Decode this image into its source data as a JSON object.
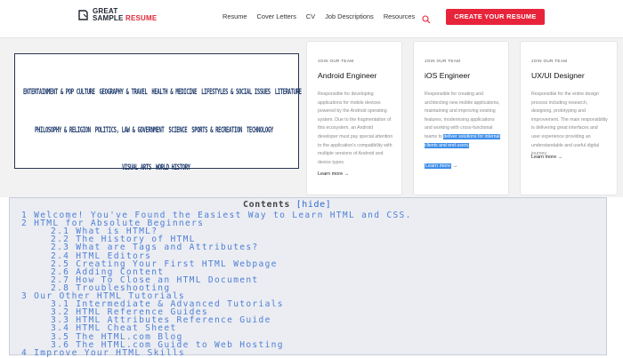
{
  "header": {
    "logo_line1": "GREAT",
    "logo_line2a": "SAMPLE ",
    "logo_line2b": "RESUME",
    "nav": [
      "Resume",
      "Cover Letters",
      "CV",
      "Job Descriptions",
      "Resources"
    ],
    "cta_label": "CREATE YOUR RESUME",
    "accent_color": "#e8243a",
    "search_icon": "search-icon"
  },
  "categories": {
    "row1": [
      "ENTERTAINMENT & POP CULTURE",
      "GEOGRAPHY & TRAVEL",
      "HEALTH & MEDICINE",
      "LIFESTYLES & SOCIAL ISSUES",
      "LITERATURE"
    ],
    "row2": [
      "PHILOSOPHY & RELIGION",
      "POLITICS, LAW & GOVERNMENT",
      "SCIENCE",
      "SPORTS & RECREATION",
      "TECHNOLOGY"
    ],
    "row3": [
      "VISUAL ARTS",
      "WORLD HISTORY"
    ]
  },
  "cards": [
    {
      "kicker": "JOIN OUR TEAM",
      "title": "Android Engineer",
      "body": "Responsible for developing applications for mobile devices powered by the Android operating system. Due to the fragmentation of this ecosystem, an Android developer must pay special attention to the application's compatibility with multiple versions of Android and device types.",
      "more": "Learn more →"
    },
    {
      "kicker": "JOIN OUR TEAM",
      "title": "iOS Engineer",
      "body_plain": "Responsible for creating and architecting new mobile applications, maintaining and improving existing features, modernising applications and working with cross-functional teams to",
      "body_highlight": "deliver solutions for internal clients and end users.",
      "more": "Learn more",
      "more_arrow": " →"
    },
    {
      "kicker": "JOIN OUR TEAM",
      "title": "UX/UI Designer",
      "body": "Responsible for the entire design process including research, designing, prototyping and improvement. The main responsibility is delivering great interfaces and user experience providing an understandable and useful digital journey.",
      "more": "Learn more →"
    }
  ],
  "contents": {
    "title": "Contents",
    "hide": "[hide]",
    "items": [
      "1 Welcome! You've Found the Easiest Way to Learn HTML and CSS.",
      "2 HTML for Absolute Beginners",
      "2.1 What is HTML?",
      "2.2 The History of HTML",
      "2.3 What are Tags and Attributes?",
      "2.4 HTML Editors",
      "2.5 Creating Your First HTML Webpage",
      "2.6 Adding Content",
      "2.7 How To Close an HTML Document",
      "2.8 Troubleshooting",
      "3 Our Other HTML Tutorials",
      "3.1 Intermediate & Advanced Tutorials",
      "3.2 HTML Reference Guides",
      "3.3 HTML Attributes Reference Guide",
      "3.4 HTML Cheat Sheet",
      "3.5 The HTML.com Blog",
      "3.6 The HTML.com Guide to Web Hosting",
      "4 Improve Your HTML Skills"
    ]
  }
}
